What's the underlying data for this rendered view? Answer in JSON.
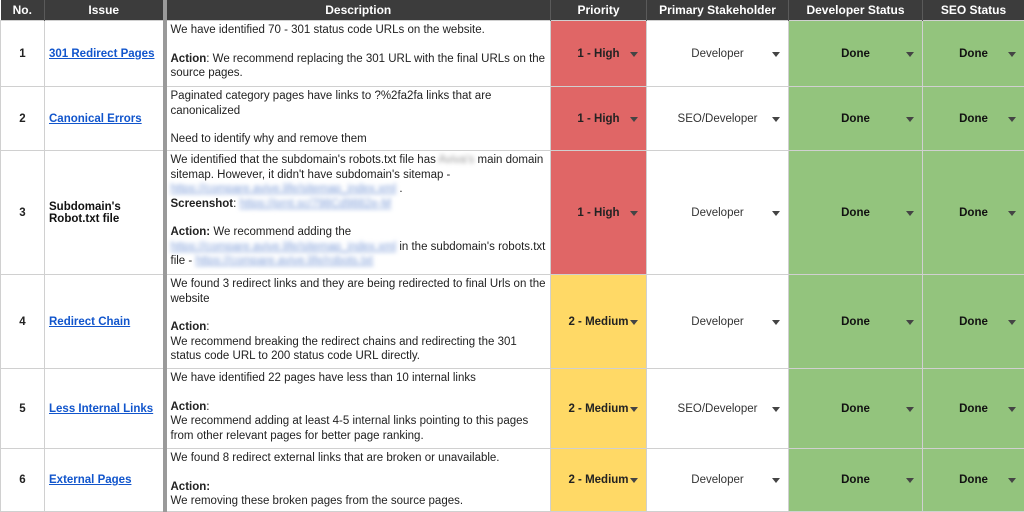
{
  "headers": {
    "no": "No.",
    "issue": "Issue",
    "description": "Description",
    "priority": "Priority",
    "stakeholder": "Primary Stakeholder",
    "dev_status": "Developer Status",
    "seo_status": "SEO Status"
  },
  "rows": [
    {
      "no": "1",
      "issue": "301 Redirect Pages",
      "desc": {
        "p1": "We have identified 70 - 301 status code URLs on the website.",
        "action_label": "Action",
        "action_text": ": We recommend replacing the 301 URL with the final URLs on the source pages."
      },
      "priority": "1 - High",
      "stakeholder": "Developer",
      "dev_status": "Done",
      "seo_status": "Done"
    },
    {
      "no": "2",
      "issue": "Canonical Errors",
      "desc": {
        "p1": "Paginated category pages have links to ?%2fa2fa links that are canonicalized",
        "p2": "Need to identify why and remove them"
      },
      "priority": "1 - High",
      "stakeholder": "SEO/Developer",
      "dev_status": "Done",
      "seo_status": "Done"
    },
    {
      "no": "3",
      "issue": "Subdomain's Robot.txt file",
      "desc": {
        "p1a": "We identified that the subdomain's robots.txt file has",
        "blur_name": "Aviva's",
        "p1b": "main domain sitemap. However,  it didn't have subdomain's sitemap -",
        "blur_link1": "https://compare.avive.life/sitemap_index.xml",
        "p1c": ".",
        "screenshot_label": "Screenshot",
        "blur_link2": "https://prnt.sc/798Cd9882e-M",
        "action_label": "Action:",
        "action_a": "We recommend adding the",
        "blur_link3": "https://compare.avive.life/sitemap_index.xml",
        "action_b": "in the subdomain's robots.txt file -",
        "blur_link4": "https://compare.avive.life/robots.txt"
      },
      "priority": "1 - High",
      "stakeholder": "Developer",
      "dev_status": "Done",
      "seo_status": "Done"
    },
    {
      "no": "4",
      "issue": "Redirect Chain",
      "desc": {
        "p1": "We found 3 redirect links and they are being redirected to final Urls on the website",
        "action_label": "Action",
        "action_colon": ":",
        "action_text": "We recommend breaking the redirect chains and redirecting the 301 status code URL to 200 status code URL directly."
      },
      "priority": "2 - Medium",
      "stakeholder": "Developer",
      "dev_status": "Done",
      "seo_status": "Done"
    },
    {
      "no": "5",
      "issue": "Less Internal Links",
      "desc": {
        "p1": "We have identified  22 pages have less than 10 internal links",
        "action_label": "Action",
        "action_colon": ":",
        "action_text": "We recommend adding at least 4-5 internal links pointing to this pages from other relevant pages for better page ranking."
      },
      "priority": "2 - Medium",
      "stakeholder": "SEO/Developer",
      "dev_status": "Done",
      "seo_status": "Done"
    },
    {
      "no": "6",
      "issue": "External Pages",
      "desc": {
        "p1": "We found 8 redirect external links that are broken or unavailable.",
        "action_label": "Action:",
        "action_text": "We removing these broken pages from the source pages."
      },
      "priority": "2 - Medium",
      "stakeholder": "Developer",
      "dev_status": "Done",
      "seo_status": "Done"
    }
  ],
  "colors": {
    "header_bg": "#3c3c3c",
    "high": "#e06666",
    "medium": "#ffd966",
    "done": "#93c47d",
    "link": "#1155cc"
  }
}
